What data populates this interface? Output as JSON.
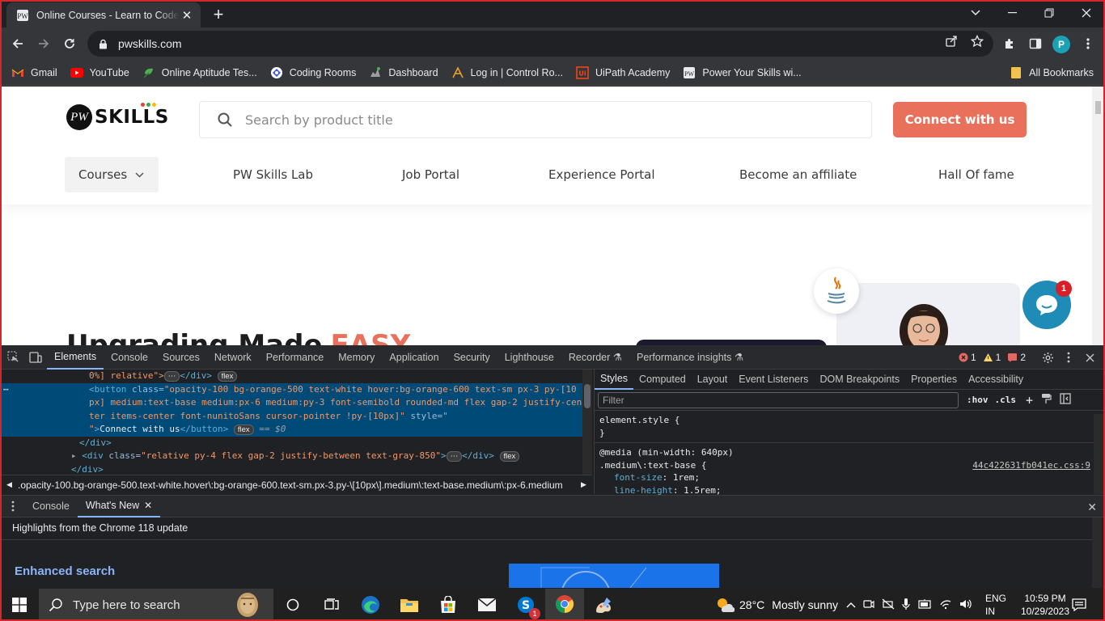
{
  "browser": {
    "tab_title": "Online Courses - Learn to Code a",
    "url": "pwskills.com",
    "profile_initial": "P"
  },
  "bookmarks": {
    "items": [
      {
        "label": "Gmail",
        "icon": "gmail-icon"
      },
      {
        "label": "YouTube",
        "icon": "youtube-icon"
      },
      {
        "label": "Online Aptitude Tes...",
        "icon": "aptitude-icon"
      },
      {
        "label": "Coding Rooms",
        "icon": "coding-rooms-icon"
      },
      {
        "label": "Dashboard",
        "icon": "dashboard-icon"
      },
      {
        "label": "Log in | Control Ro...",
        "icon": "control-room-icon"
      },
      {
        "label": "UiPath Academy",
        "icon": "uipath-icon"
      },
      {
        "label": "Power Your Skills wi...",
        "icon": "pw-skills-icon"
      }
    ],
    "all_label": "All Bookmarks"
  },
  "site": {
    "logo_text": "SKILLS",
    "logo_mark": "PW",
    "search_placeholder": "Search by product title",
    "cta_label": "Connect with us",
    "nav": {
      "courses": "Courses",
      "lab": "PW Skills Lab",
      "jobs": "Job Portal",
      "experience": "Experience Portal",
      "affiliate": "Become an affiliate",
      "hall": "Hall Of fame"
    },
    "hero_title": "Upgrading Made",
    "hero_accent": "EASY",
    "chat_badge": "1",
    "colors": {
      "accent": "#e9715c",
      "chat": "#1f8bb7"
    }
  },
  "devtools": {
    "tabs": [
      "Elements",
      "Console",
      "Sources",
      "Network",
      "Performance",
      "Memory",
      "Application",
      "Security",
      "Lighthouse",
      "Recorder ⚗",
      "Performance insights ⚗"
    ],
    "errors": "1",
    "warnings": "1",
    "issues": "2",
    "elements": {
      "line1_text": "0%] relative\">",
      "line1_close": "</div>",
      "btn_attr_val1": "\"opacity-100 bg-orange-500 text-white hover:bg-orange-600 text-sm px-3 py-[10",
      "btn_attr_val2": "px] medium:text-base medium:px-6 medium:py-3 font-semibold rounded-md flex gap-2 justify-cen",
      "btn_attr_val3": "ter items-center font-nunitoSans cursor-pointer !py-[10px]\"",
      "btn_text": "Connect with us",
      "dollar": "== $0",
      "div_close": "</div>",
      "div2_val": "\"relative py-4 flex gap-2 justify-between text-gray-850\"",
      "div3_close": "</div>",
      "flex_pill": "flex"
    },
    "breadcrumb": ".opacity-100.bg-orange-500.text-white.hover\\:bg-orange-600.text-sm.px-3.py-\\[10px\\].medium\\:text-base.medium\\:px-6.medium",
    "styles": {
      "tabs": [
        "Styles",
        "Computed",
        "Layout",
        "Event Listeners",
        "DOM Breakpoints",
        "Properties",
        "Accessibility"
      ],
      "filter_placeholder": "Filter",
      "hov": ":hov",
      "cls": ".cls",
      "element_style": "element.style {",
      "close_brace": "}",
      "media": "@media (min-width: 640px)",
      "selector": ".medium\\:text-base {",
      "source_link": "44c422631fb041ec.css:9",
      "prop1": "font-size",
      "val1": "1rem;",
      "prop2": "line-height",
      "val2": "1.5rem;"
    },
    "drawer": {
      "tab_console": "Console",
      "tab_whats_new": "What's New",
      "highlight": "Highlights from the Chrome 118 update",
      "heading": "Enhanced search"
    }
  },
  "taskbar": {
    "search_placeholder": "Type here to search",
    "weather_temp": "28°C",
    "weather_text": "Mostly sunny",
    "lang_top": "ENG",
    "lang_bottom": "IN",
    "time": "10:59 PM",
    "date": "10/29/2023",
    "skype_badge": "1"
  }
}
